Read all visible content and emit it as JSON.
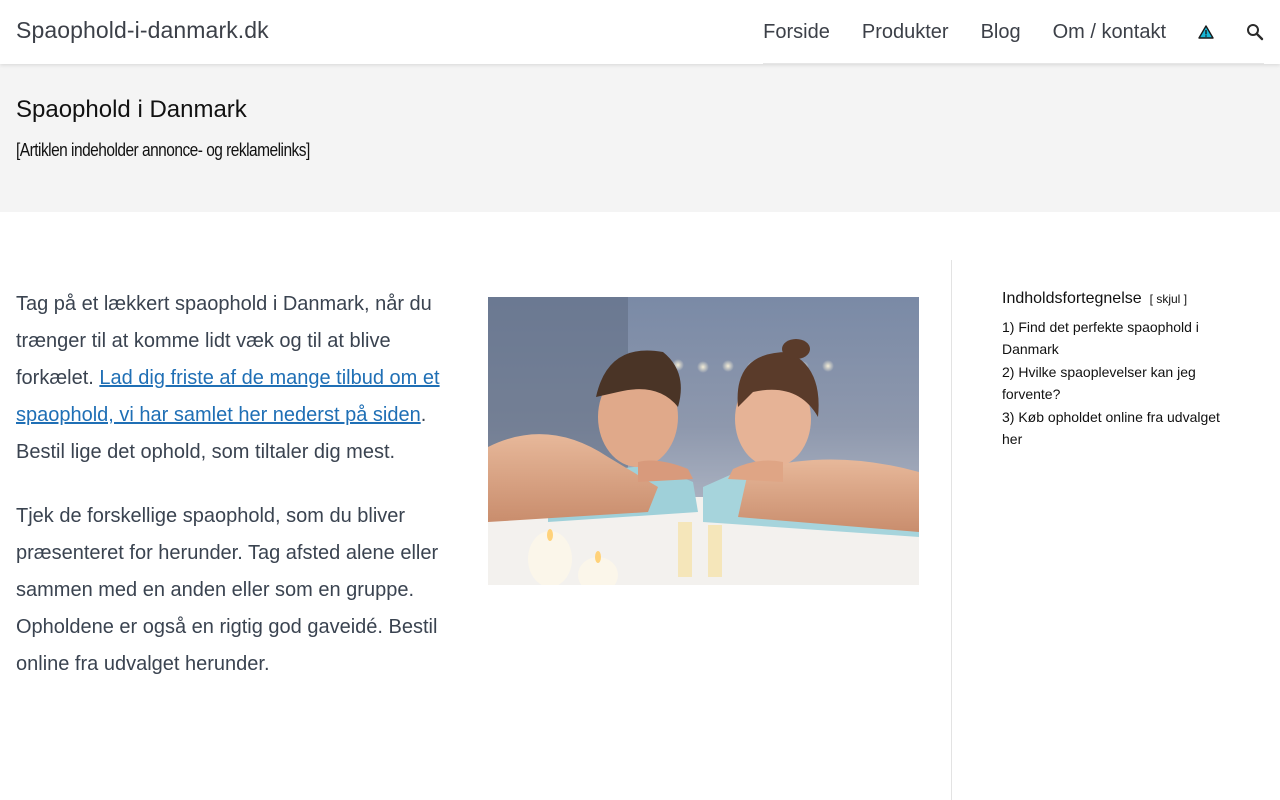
{
  "header": {
    "brand": "Spaophold-i-danmark.dk",
    "nav": [
      "Forside",
      "Produkter",
      "Blog",
      "Om / kontakt"
    ],
    "icons": [
      "warning-triangle-icon",
      "search-icon"
    ]
  },
  "hero": {
    "title": "Spaophold i Danmark",
    "disclaimer": "[Artiklen indeholder annonce- og reklamelinks]"
  },
  "content": {
    "p1_before": "Tag på et lækkert spaophold i Danmark, når du trænger til at komme lidt væk og til at blive forkælet. ",
    "p1_link": "Lad dig friste af de mange tilbud om et spaophold, vi har samlet her nederst på siden",
    "p1_after": ". Bestil lige det ophold, som tiltaler dig mest.",
    "p2": "Tjek de forskellige spaophold, som du bliver præsenteret for herunder. Tag afsted alene eller sammen med en anden eller som en gruppe. Opholdene er også en rigtig god gaveidé. Bestil online fra udvalget herunder."
  },
  "toc": {
    "title": "Indholdsfortegnelse",
    "toggle_open": "[",
    "toggle_label": "skjul",
    "toggle_close": "]",
    "items": [
      {
        "num": "1)",
        "label": "Find det perfekte spaophold i Danmark"
      },
      {
        "num": "2)",
        "label": "Hvilke spaoplevelser kan jeg forvente?"
      },
      {
        "num": "3)",
        "label": "Køb opholdet online fra udvalget her"
      }
    ]
  },
  "colors": {
    "link": "#1f6fb5",
    "hero_bg": "#f4f4f4",
    "body_text": "#3a4350"
  }
}
